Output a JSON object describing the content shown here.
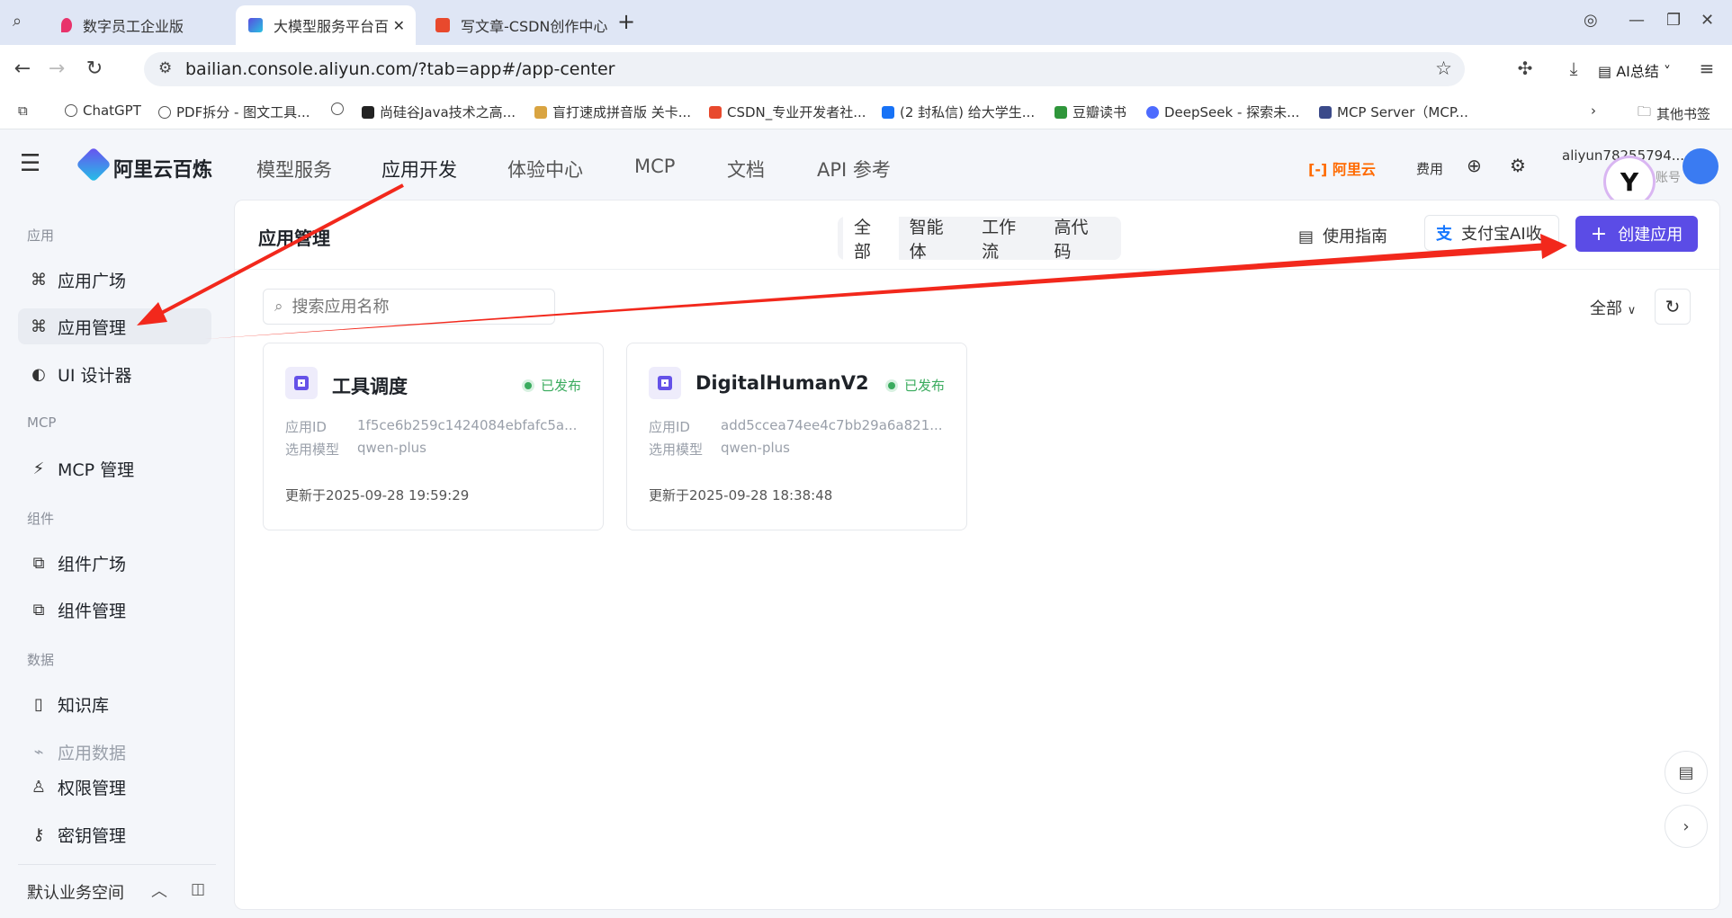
{
  "browser": {
    "tabs": [
      {
        "label": "数字员工企业版",
        "color": "#e8336b"
      },
      {
        "label": "大模型服务平台百",
        "color": "#5a4be0"
      },
      {
        "label": "写文章-CSDN创作中心",
        "color": "#e8492d"
      }
    ],
    "new_tab": "+",
    "url": "bailian.console.aliyun.com/?tab=app#/app-center",
    "ai_summary": "AI总结",
    "bookmarks": [
      "ChatGPT",
      "PDF拆分 - 图文工具...",
      "尚硅谷Java技术之高...",
      "盲打速成拼音版 关卡...",
      "CSDN_专业开发者社...",
      "(2 封私信) 给大学生...",
      "豆瓣读书",
      "DeepSeek - 探索未...",
      "MCP Server（MCP...",
      "其他书签"
    ]
  },
  "header": {
    "brand": "阿里云百炼",
    "nav": [
      "模型服务",
      "应用开发",
      "体验中心",
      "MCP",
      "文档",
      "API 参考"
    ],
    "aliyun": "阿里云",
    "fee": "费用",
    "account": "aliyun78255794...",
    "account_sub": "主账号"
  },
  "sidebar": {
    "sections": [
      {
        "title": "应用",
        "items": [
          "应用广场",
          "应用管理",
          "UI 设计器"
        ]
      },
      {
        "title": "MCP",
        "items": [
          "MCP 管理"
        ]
      },
      {
        "title": "组件",
        "items": [
          "组件广场",
          "组件管理"
        ]
      },
      {
        "title": "数据",
        "items": [
          "知识库",
          "应用数据",
          "权限管理",
          "密钥管理"
        ]
      }
    ],
    "workspace": "默认业务空间"
  },
  "main": {
    "title": "应用管理",
    "segments": [
      "全部",
      "智能体",
      "工作流",
      "高代码"
    ],
    "guide": "使用指南",
    "alipay": "支付宝AI收",
    "create": "创建应用",
    "search_placeholder": "搜索应用名称",
    "filter": "全部",
    "cards": [
      {
        "name": "工具调度",
        "status": "已发布",
        "id_label": "应用ID",
        "id": "1f5ce6b259c1424084ebfafc5a...",
        "model_label": "选用模型",
        "model": "qwen-plus",
        "updated": "更新于2025-09-28 19:59:29"
      },
      {
        "name": "DigitalHumanV2",
        "status": "已发布",
        "id_label": "应用ID",
        "id": "add5ccea74ee4c7bb29a6a821...",
        "model_label": "选用模型",
        "model": "qwen-plus",
        "updated": "更新于2025-09-28 18:38:48"
      }
    ]
  },
  "colors": {
    "accent": "#5b4ce6",
    "annotation": "#f2281c",
    "published": "#3aab5e"
  }
}
